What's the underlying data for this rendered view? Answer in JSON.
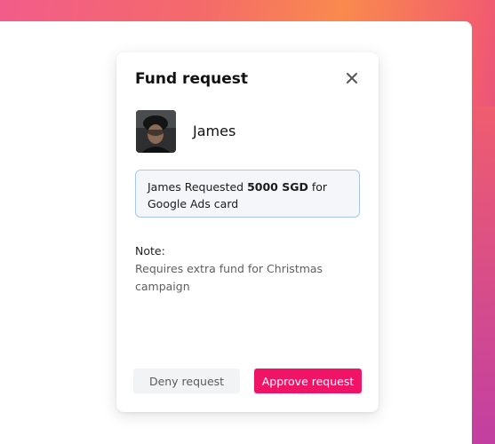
{
  "modal": {
    "title": "Fund request",
    "requester_name": "James",
    "request_prefix": "James Requested",
    "amount": "5000 SGD",
    "request_suffix": "for",
    "request_line2": "Google Ads card",
    "note_label": "Note:",
    "note_text": "Requires extra fund for Christmas campaign",
    "deny_label": "Deny request",
    "approve_label": "Approve request"
  },
  "colors": {
    "approve": "#f01467",
    "deny_bg": "#f2f3f5",
    "request_border": "#a9c7ea"
  },
  "icons": {
    "close": "close-icon",
    "avatar": "avatar"
  }
}
